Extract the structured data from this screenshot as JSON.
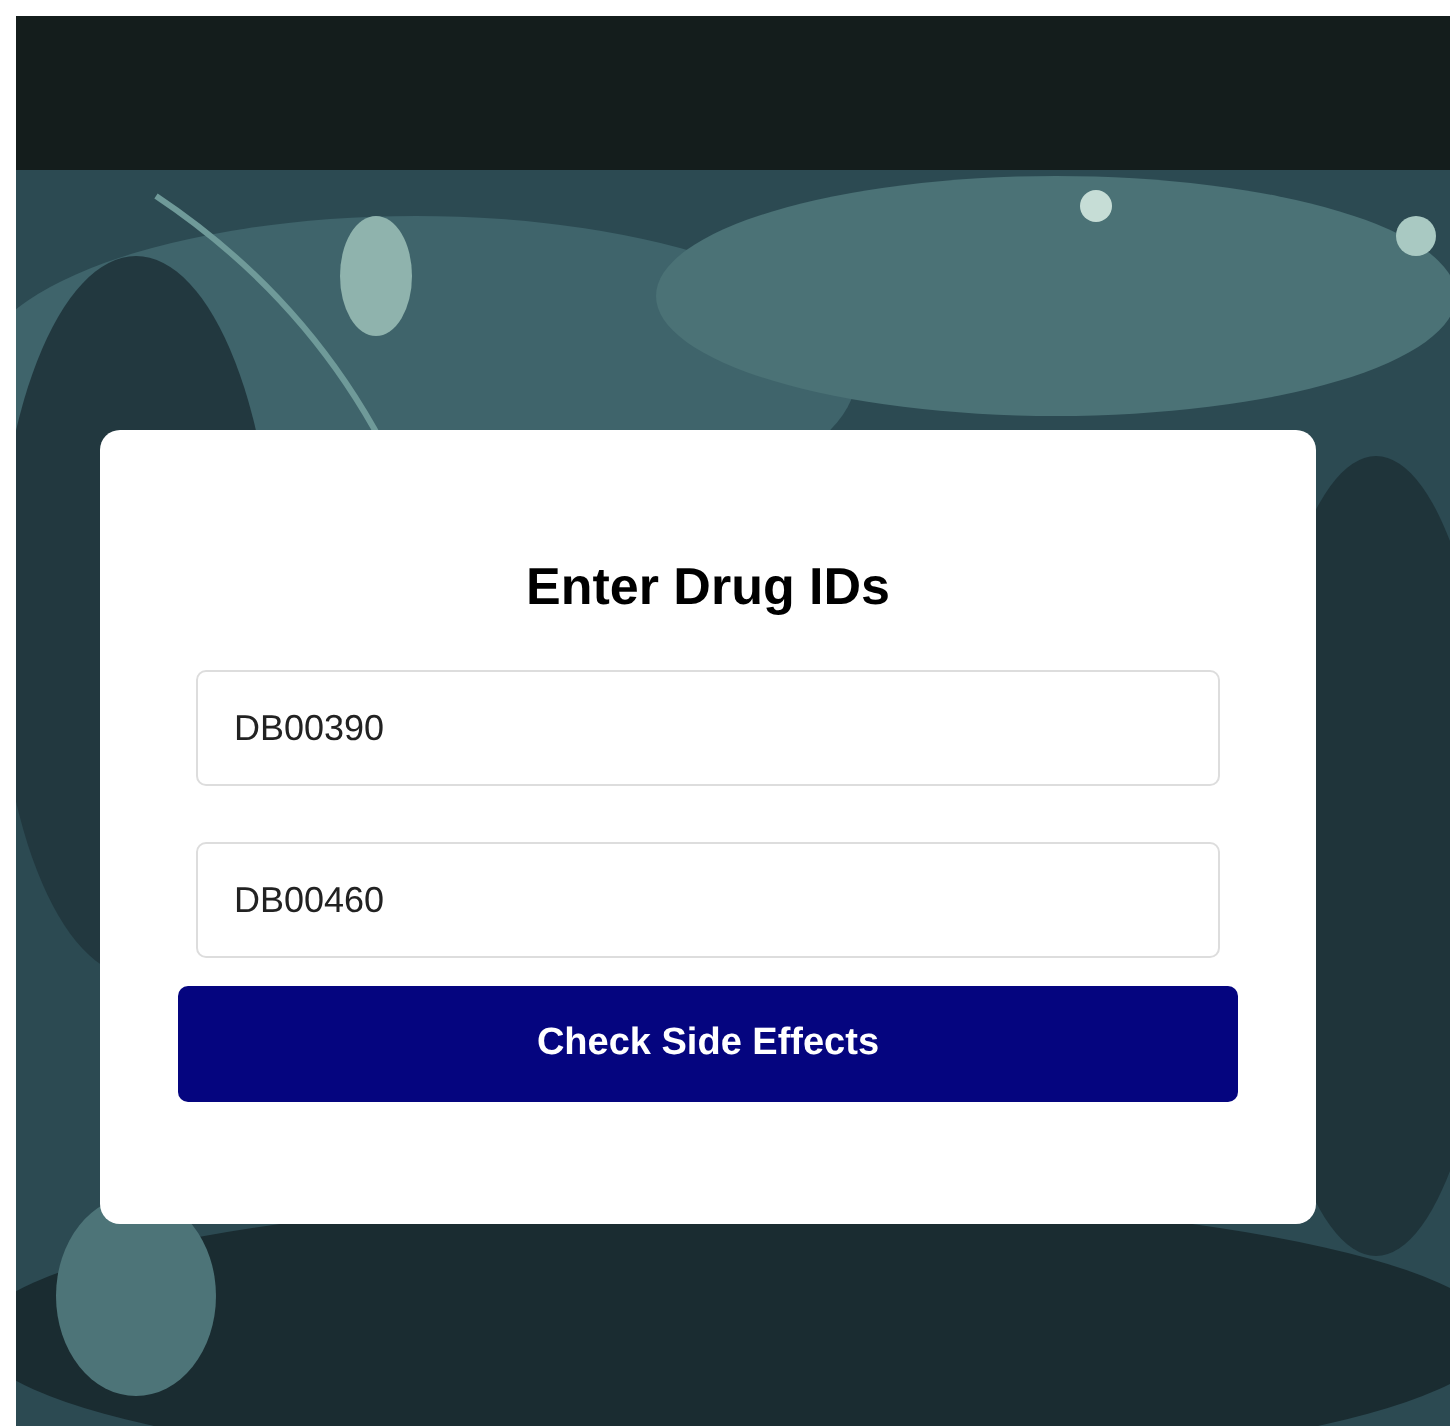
{
  "form": {
    "title": "Enter Drug IDs",
    "fields": [
      {
        "value": "DB00390"
      },
      {
        "value": "DB00460"
      }
    ],
    "button": "Check Side Effects"
  }
}
